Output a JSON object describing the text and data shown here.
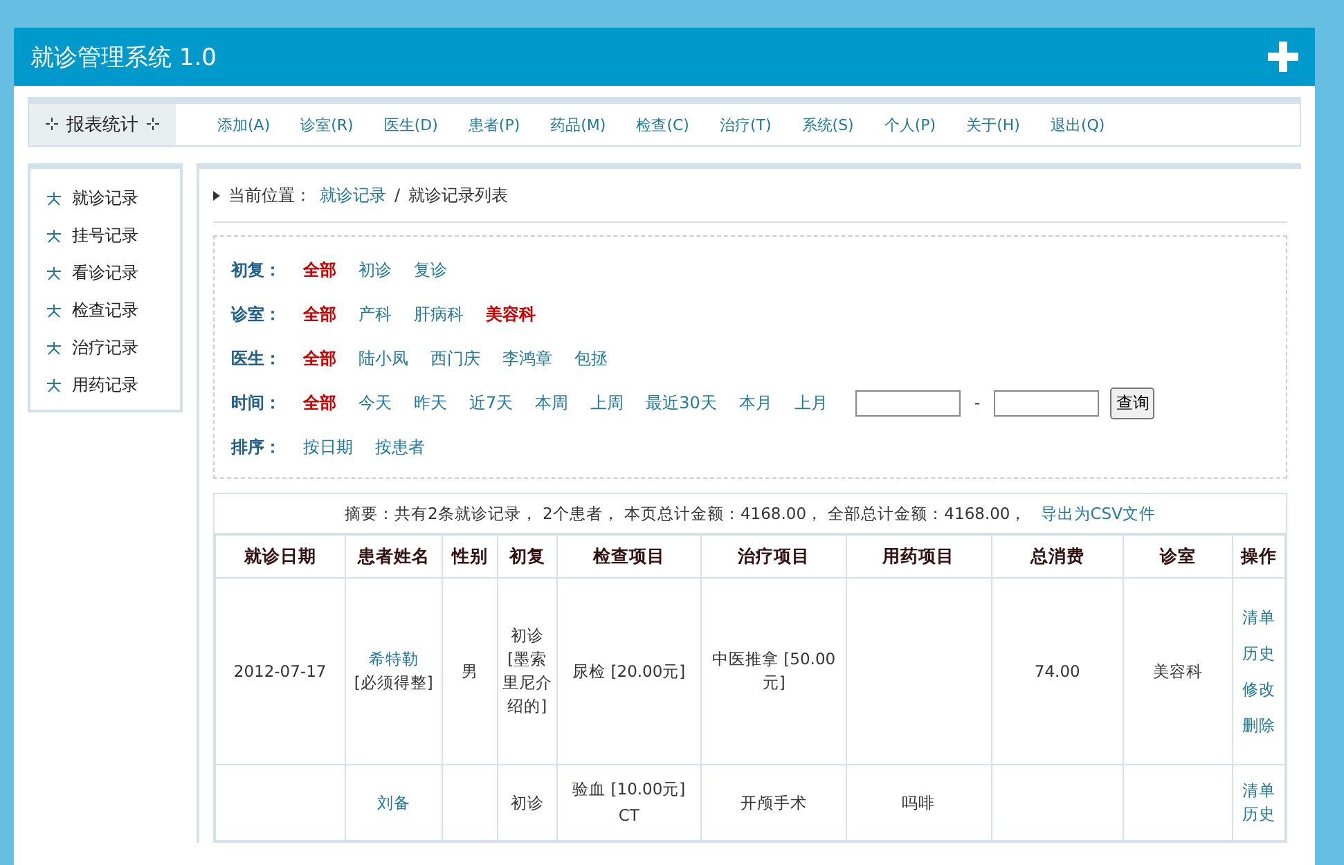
{
  "window": {
    "title": "就诊管理系统 1.0"
  },
  "menu": {
    "report": "报表统计",
    "items": [
      "添加(A)",
      "诊室(R)",
      "医生(D)",
      "患者(P)",
      "药品(M)",
      "检查(C)",
      "治疗(T)",
      "系统(S)",
      "个人(P)",
      "关于(H)",
      "退出(Q)"
    ]
  },
  "sidebar": {
    "items": [
      "就诊记录",
      "挂号记录",
      "看诊记录",
      "检查记录",
      "治疗记录",
      "用药记录"
    ]
  },
  "breadcrumb": {
    "label": "当前位置：",
    "link": "就诊记录",
    "separator": "/",
    "current": "就诊记录列表"
  },
  "filters": [
    {
      "label": "初复：",
      "options": [
        {
          "text": "全部",
          "selected": true
        },
        {
          "text": "初诊",
          "selected": false
        },
        {
          "text": "复诊",
          "selected": false
        }
      ]
    },
    {
      "label": "诊室：",
      "options": [
        {
          "text": "全部",
          "selected": true
        },
        {
          "text": "产科",
          "selected": false
        },
        {
          "text": "肝病科",
          "selected": false
        },
        {
          "text": "美容科",
          "selected": true
        }
      ]
    },
    {
      "label": "医生：",
      "options": [
        {
          "text": "全部",
          "selected": true
        },
        {
          "text": "陆小凤",
          "selected": false
        },
        {
          "text": "西门庆",
          "selected": false
        },
        {
          "text": "李鸿章",
          "selected": false
        },
        {
          "text": "包拯",
          "selected": false
        }
      ]
    },
    {
      "label": "时间：",
      "options": [
        {
          "text": "全部",
          "selected": true
        },
        {
          "text": "今天",
          "selected": false
        },
        {
          "text": "昨天",
          "selected": false
        },
        {
          "text": "近7天",
          "selected": false
        },
        {
          "text": "本周",
          "selected": false
        },
        {
          "text": "上周",
          "selected": false
        },
        {
          "text": "最近30天",
          "selected": false
        },
        {
          "text": "本月",
          "selected": false
        },
        {
          "text": "上月",
          "selected": false
        }
      ],
      "range": {
        "separator": "-",
        "button": "查询"
      }
    },
    {
      "label": "排序：",
      "options": [
        {
          "text": "按日期",
          "selected": false
        },
        {
          "text": "按患者",
          "selected": false
        }
      ]
    }
  ],
  "summary": {
    "text": "摘要：共有2条就诊记录， 2个患者， 本页总计金额：4168.00， 全部总计金额：4168.00，",
    "export": "导出为CSV文件"
  },
  "table": {
    "columns": [
      "就诊日期",
      "患者姓名",
      "性别",
      "初复",
      "检查项目",
      "治疗项目",
      "用药项目",
      "总消费",
      "诊室",
      "操作"
    ],
    "rows": [
      {
        "date": "2012-07-17",
        "patient": "希特勒",
        "note": "[必须得整]",
        "gender": "男",
        "visit": "初诊[墨索里尼介绍的]",
        "checks": [
          "尿检 [20.00元]"
        ],
        "treatments": [
          "中医推拿 [50.00元]"
        ],
        "drugs": [],
        "total": "74.00",
        "room": "美容科",
        "actions": [
          "清单",
          "历史",
          "修改",
          "删除"
        ]
      },
      {
        "date": "",
        "patient": "刘备",
        "note": "",
        "gender": "",
        "visit": "初诊",
        "checks": [
          "验血 [10.00元]",
          "CT"
        ],
        "treatments": [
          "开颅手术"
        ],
        "drugs": [
          "吗啡"
        ],
        "total": "",
        "room": "",
        "actions": [
          "清单",
          "历史"
        ]
      }
    ]
  }
}
